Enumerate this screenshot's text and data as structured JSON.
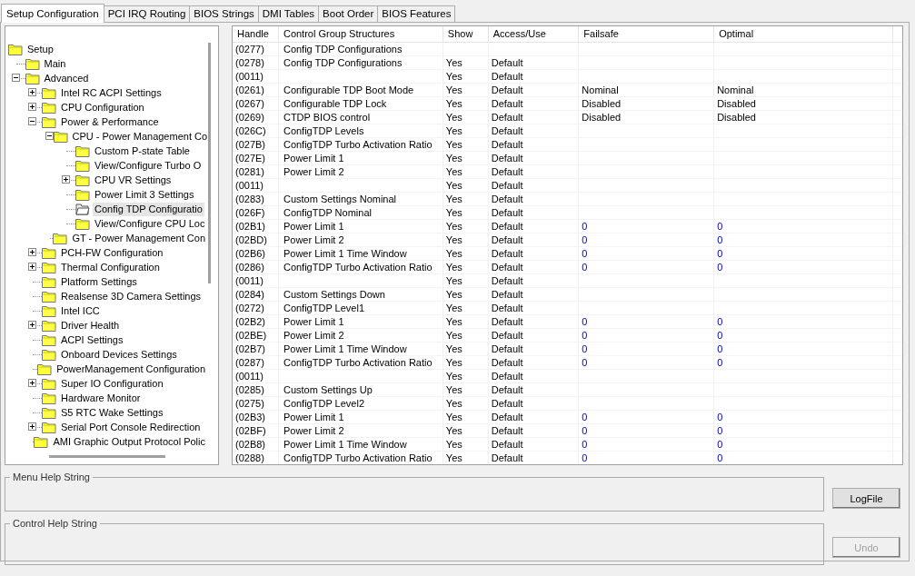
{
  "tabs": [
    {
      "label": "Setup Configuration",
      "selected": true
    },
    {
      "label": "PCI IRQ Routing",
      "selected": false
    },
    {
      "label": "BIOS Strings",
      "selected": false
    },
    {
      "label": "DMI Tables",
      "selected": false
    },
    {
      "label": "Boot Order",
      "selected": false
    },
    {
      "label": "BIOS Features",
      "selected": false
    }
  ],
  "tree": [
    {
      "label": "Setup",
      "selected": false,
      "children": [
        {
          "label": "Main",
          "selected": false
        },
        {
          "label": "Advanced",
          "expanded": true,
          "selected": false,
          "children": [
            {
              "label": "Intel RC ACPI Settings",
              "expanded": false,
              "selected": false
            },
            {
              "label": "CPU Configuration",
              "expanded": false,
              "selected": false
            },
            {
              "label": "Power & Performance",
              "expanded": true,
              "selected": false,
              "children": [
                {
                  "label": "CPU - Power Management Co",
                  "expanded": true,
                  "selected": false,
                  "children": [
                    {
                      "label": "Custom P-state Table",
                      "selected": false
                    },
                    {
                      "label": "View/Configure Turbo O",
                      "selected": false
                    },
                    {
                      "label": "CPU VR Settings",
                      "expanded": false,
                      "selected": false
                    },
                    {
                      "label": "Power Limit 3 Settings",
                      "selected": false
                    },
                    {
                      "label": "Config TDP Configuratio",
                      "selected": true
                    },
                    {
                      "label": "View/Configure CPU Loc",
                      "selected": false
                    }
                  ]
                },
                {
                  "label": "GT - Power Management Con",
                  "selected": false
                }
              ]
            },
            {
              "label": "PCH-FW Configuration",
              "expanded": false,
              "selected": false
            },
            {
              "label": "Thermal Configuration",
              "expanded": false,
              "selected": false
            },
            {
              "label": "Platform Settings",
              "selected": false
            },
            {
              "label": "Realsense 3D Camera Settings",
              "selected": false
            },
            {
              "label": "Intel ICC",
              "selected": false
            },
            {
              "label": "Driver Health",
              "expanded": false,
              "selected": false
            },
            {
              "label": "ACPI Settings",
              "selected": false
            },
            {
              "label": "Onboard Devices Settings",
              "selected": false
            },
            {
              "label": "PowerManagement Configuration",
              "selected": false
            },
            {
              "label": "Super IO Configuration",
              "expanded": false,
              "selected": false
            },
            {
              "label": "Hardware Monitor",
              "selected": false
            },
            {
              "label": "S5 RTC Wake Settings",
              "selected": false
            },
            {
              "label": "Serial Port Console Redirection",
              "expanded": false,
              "selected": false
            },
            {
              "label": "AMI Graphic Output Protocol Polic",
              "selected": false
            }
          ]
        }
      ]
    }
  ],
  "table": {
    "columns": [
      "Handle",
      "Control Group Structures",
      "Show",
      "Access/Use",
      "Failsafe",
      "Optimal"
    ],
    "rows": [
      {
        "handle": "(0277)",
        "structure": "Config TDP Configurations"
      },
      {
        "handle": "(0278)",
        "structure": "Config TDP Configurations",
        "show": "Yes",
        "access": "Default"
      },
      {
        "handle": "(0011)",
        "show": "Yes",
        "access": "Default"
      },
      {
        "handle": "(0261)",
        "structure": "Configurable TDP Boot Mode",
        "show": "Yes",
        "access": "Default",
        "failsafe": "Nominal",
        "optimal": "Nominal",
        "kind": "option"
      },
      {
        "handle": "(0267)",
        "structure": "Configurable TDP Lock",
        "show": "Yes",
        "access": "Default",
        "failsafe": "Disabled",
        "optimal": "Disabled",
        "kind": "option"
      },
      {
        "handle": "(0269)",
        "structure": "CTDP BIOS control",
        "show": "Yes",
        "access": "Default",
        "failsafe": "Disabled",
        "optimal": "Disabled",
        "kind": "option"
      },
      {
        "handle": "(026C)",
        "structure": "ConfigTDP Levels",
        "show": "Yes",
        "access": "Default"
      },
      {
        "handle": "(027B)",
        "structure": "ConfigTDP Turbo Activation Ratio",
        "show": "Yes",
        "access": "Default"
      },
      {
        "handle": "(027E)",
        "structure": "Power Limit 1",
        "show": "Yes",
        "access": "Default"
      },
      {
        "handle": "(0281)",
        "structure": "Power Limit 2",
        "show": "Yes",
        "access": "Default"
      },
      {
        "handle": "(0011)",
        "show": "Yes",
        "access": "Default"
      },
      {
        "handle": "(0283)",
        "structure": "Custom Settings Nominal",
        "show": "Yes",
        "access": "Default"
      },
      {
        "handle": "(026F)",
        "structure": "ConfigTDP Nominal",
        "show": "Yes",
        "access": "Default"
      },
      {
        "handle": "(02B1)",
        "structure": "Power Limit 1",
        "show": "Yes",
        "access": "Default",
        "failsafe": "0",
        "optimal": "0",
        "kind": "numeric"
      },
      {
        "handle": "(02BD)",
        "structure": "Power Limit 2",
        "show": "Yes",
        "access": "Default",
        "failsafe": "0",
        "optimal": "0",
        "kind": "numeric"
      },
      {
        "handle": "(02B6)",
        "structure": "Power Limit 1 Time Window",
        "show": "Yes",
        "access": "Default",
        "failsafe": "0",
        "optimal": "0",
        "kind": "numeric"
      },
      {
        "handle": "(0286)",
        "structure": "ConfigTDP Turbo Activation Ratio",
        "show": "Yes",
        "access": "Default",
        "failsafe": "0",
        "optimal": "0",
        "kind": "numeric"
      },
      {
        "handle": "(0011)",
        "show": "Yes",
        "access": "Default"
      },
      {
        "handle": "(0284)",
        "structure": "Custom Settings Down",
        "show": "Yes",
        "access": "Default"
      },
      {
        "handle": "(0272)",
        "structure": "ConfigTDP Level1",
        "show": "Yes",
        "access": "Default"
      },
      {
        "handle": "(02B2)",
        "structure": "Power Limit 1",
        "show": "Yes",
        "access": "Default",
        "failsafe": "0",
        "optimal": "0",
        "kind": "numeric"
      },
      {
        "handle": "(02BE)",
        "structure": "Power Limit 2",
        "show": "Yes",
        "access": "Default",
        "failsafe": "0",
        "optimal": "0",
        "kind": "numeric"
      },
      {
        "handle": "(02B7)",
        "structure": "Power Limit 1 Time Window",
        "show": "Yes",
        "access": "Default",
        "failsafe": "0",
        "optimal": "0",
        "kind": "numeric"
      },
      {
        "handle": "(0287)",
        "structure": "ConfigTDP Turbo Activation Ratio",
        "show": "Yes",
        "access": "Default",
        "failsafe": "0",
        "optimal": "0",
        "kind": "numeric"
      },
      {
        "handle": "(0011)",
        "show": "Yes",
        "access": "Default"
      },
      {
        "handle": "(0285)",
        "structure": "Custom Settings Up",
        "show": "Yes",
        "access": "Default"
      },
      {
        "handle": "(0275)",
        "structure": "ConfigTDP Level2",
        "show": "Yes",
        "access": "Default"
      },
      {
        "handle": "(02B3)",
        "structure": "Power Limit 1",
        "show": "Yes",
        "access": "Default",
        "failsafe": "0",
        "optimal": "0",
        "kind": "numeric"
      },
      {
        "handle": "(02BF)",
        "structure": "Power Limit 2",
        "show": "Yes",
        "access": "Default",
        "failsafe": "0",
        "optimal": "0",
        "kind": "numeric"
      },
      {
        "handle": "(02B8)",
        "structure": "Power Limit 1 Time Window",
        "show": "Yes",
        "access": "Default",
        "failsafe": "0",
        "optimal": "0",
        "kind": "numeric"
      },
      {
        "handle": "(0288)",
        "structure": "ConfigTDP Turbo Activation Ratio",
        "show": "Yes",
        "access": "Default",
        "failsafe": "0",
        "optimal": "0",
        "kind": "numeric"
      }
    ]
  },
  "help_boxes": [
    "Menu Help String",
    "Control Help String"
  ],
  "buttons": [
    {
      "label": "LogFile",
      "disabled": false
    },
    {
      "label": "Undo",
      "disabled": true
    }
  ]
}
